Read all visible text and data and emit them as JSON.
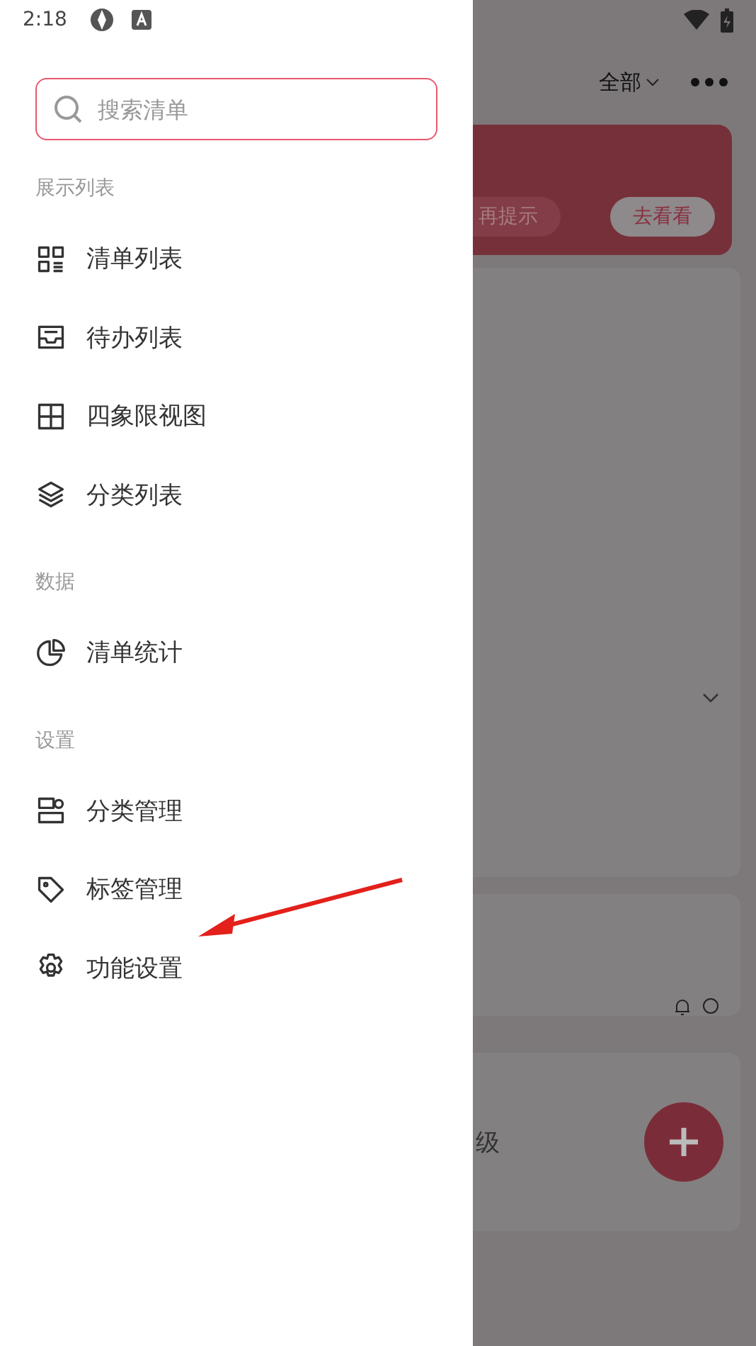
{
  "status_bar": {
    "time": "2:18"
  },
  "search": {
    "placeholder": "搜索清单"
  },
  "sections": [
    {
      "title": "展示列表",
      "items": [
        {
          "label": "清单列表"
        },
        {
          "label": "待办列表"
        },
        {
          "label": "四象限视图"
        },
        {
          "label": "分类列表"
        }
      ]
    },
    {
      "title": "数据",
      "items": [
        {
          "label": "清单统计"
        }
      ]
    },
    {
      "title": "设置",
      "items": [
        {
          "label": "分类管理"
        },
        {
          "label": "标签管理"
        },
        {
          "label": "功能设置"
        }
      ]
    }
  ],
  "background": {
    "filter": "全部",
    "banner_buttons": [
      "再提示",
      "去看看"
    ],
    "card_text": "级"
  }
}
